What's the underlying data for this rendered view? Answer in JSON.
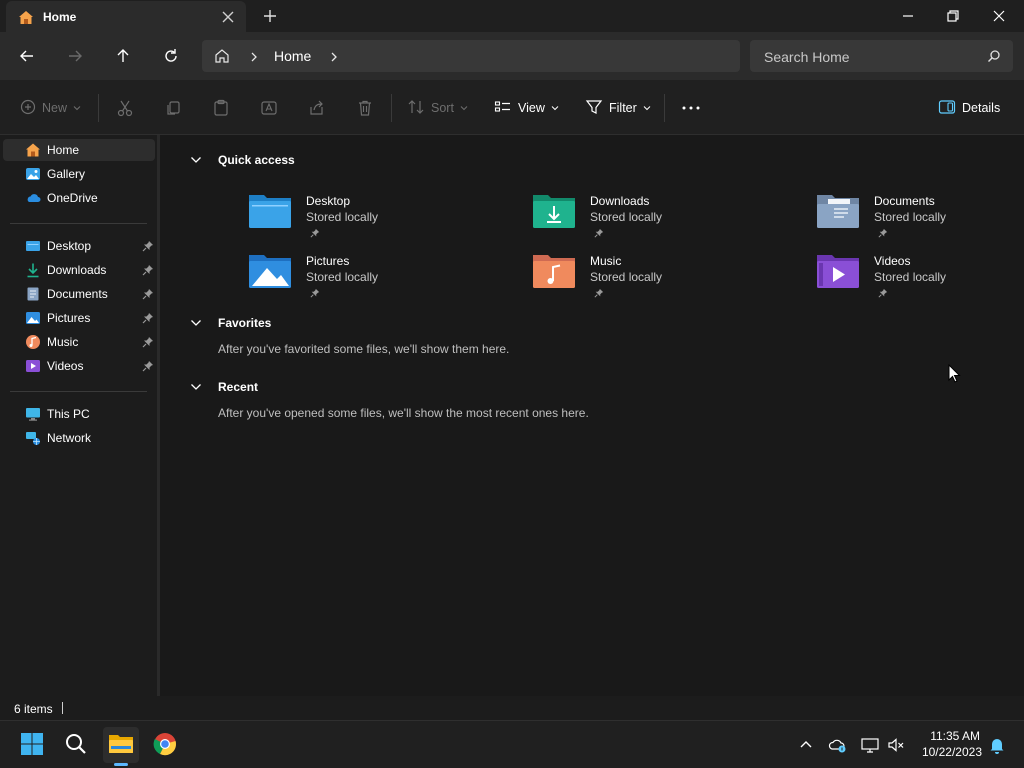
{
  "window": {
    "tab_title": "Home"
  },
  "address": {
    "location": "Home",
    "search_placeholder": "Search Home"
  },
  "toolbar": {
    "new_label": "New",
    "sort_label": "Sort",
    "view_label": "View",
    "filter_label": "Filter",
    "details_label": "Details"
  },
  "sidebar": {
    "top": [
      {
        "label": "Home",
        "icon": "home-icon"
      },
      {
        "label": "Gallery",
        "icon": "gallery-icon"
      },
      {
        "label": "OneDrive",
        "icon": "cloud-icon"
      }
    ],
    "pinned": [
      {
        "label": "Desktop",
        "icon": "desktop-folder-icon"
      },
      {
        "label": "Downloads",
        "icon": "download-icon"
      },
      {
        "label": "Documents",
        "icon": "documents-icon"
      },
      {
        "label": "Pictures",
        "icon": "pictures-icon"
      },
      {
        "label": "Music",
        "icon": "music-icon"
      },
      {
        "label": "Videos",
        "icon": "videos-icon"
      }
    ],
    "devices": [
      {
        "label": "This PC",
        "icon": "computer-icon"
      },
      {
        "label": "Network",
        "icon": "network-icon"
      }
    ]
  },
  "main": {
    "quick_access": {
      "title": "Quick access",
      "items": [
        {
          "name": "Desktop",
          "sub": "Stored locally"
        },
        {
          "name": "Downloads",
          "sub": "Stored locally"
        },
        {
          "name": "Documents",
          "sub": "Stored locally"
        },
        {
          "name": "Pictures",
          "sub": "Stored locally"
        },
        {
          "name": "Music",
          "sub": "Stored locally"
        },
        {
          "name": "Videos",
          "sub": "Stored locally"
        }
      ]
    },
    "favorites": {
      "title": "Favorites",
      "message": "After you've favorited some files, we'll show them here."
    },
    "recent": {
      "title": "Recent",
      "message": "After you've opened some files, we'll show the most recent ones here."
    }
  },
  "status": {
    "item_count": "6 items"
  },
  "taskbar": {
    "time": "11:35 AM",
    "date": "10/22/2023"
  },
  "colors": {
    "accent": "#60cdff",
    "folder_blue": "#3aa3e8",
    "downloads_green": "#1fb38e",
    "music_orange": "#f08a5d",
    "videos_purple": "#8a4fd6"
  }
}
